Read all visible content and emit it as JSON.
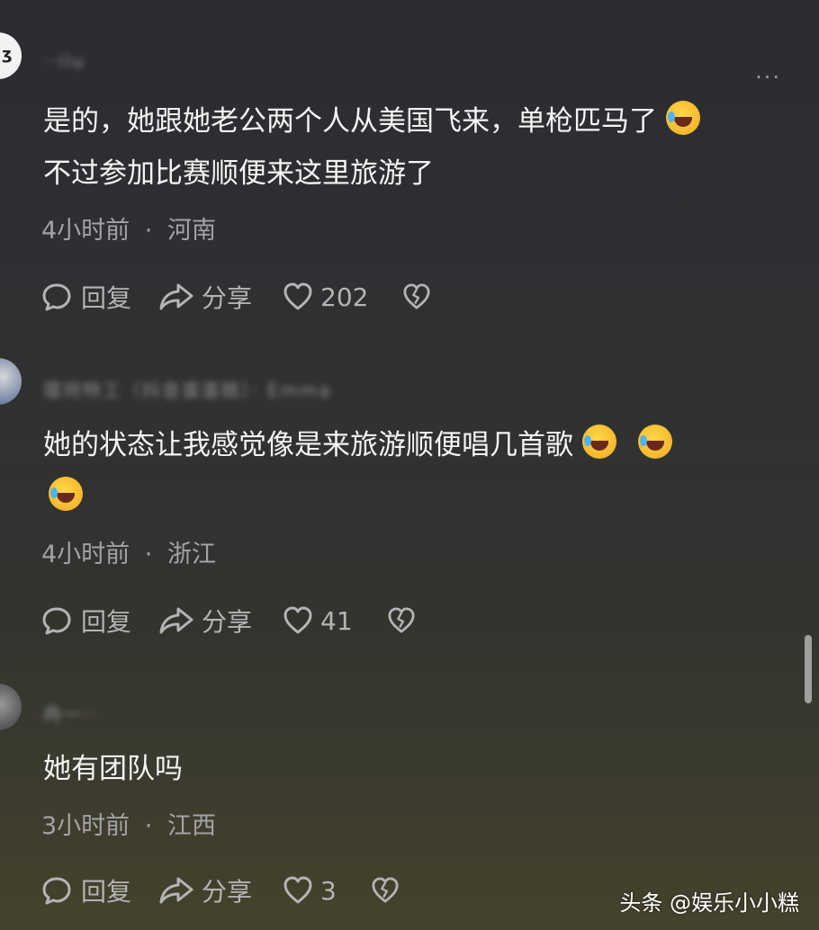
{
  "comments": [
    {
      "username": "··ilu",
      "text_line1": "是的，她跟她老公两个人从美国飞来，单枪匹马了",
      "text_line2": "不过参加比赛顺便来这里旅游了",
      "time": "4小时前",
      "location": "河南",
      "reply_label": "回复",
      "share_label": "分享",
      "likes": "202"
    },
    {
      "username": "璎珂特工（抖音蛋蛋糕）· Emma",
      "text_line1": "她的状态让我感觉像是来旅游顺便唱几首歌",
      "time": "4小时前",
      "location": "浙江",
      "reply_label": "回复",
      "share_label": "分享",
      "likes": "41"
    },
    {
      "username": "冉一··",
      "text_line1": "她有团队吗",
      "time": "3小时前",
      "location": "江西",
      "reply_label": "回复",
      "share_label": "分享",
      "likes": "3"
    }
  ],
  "separator": "·",
  "more_icon": "···",
  "watermark": "头条 @娱乐小小糕",
  "icons": {
    "reply": "chat-bubble-icon",
    "share": "share-arrow-icon",
    "like": "heart-icon",
    "dislike": "broken-heart-icon",
    "emoji": "rofl-emoji-icon"
  }
}
